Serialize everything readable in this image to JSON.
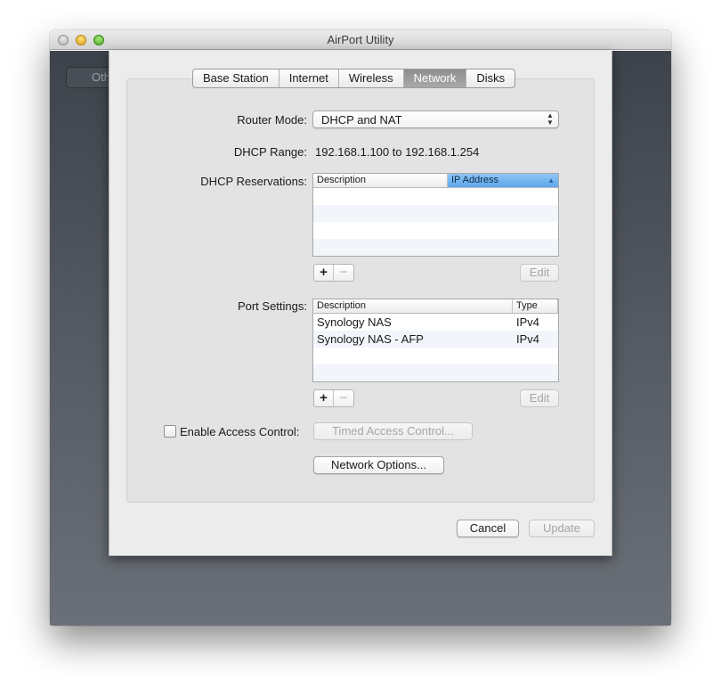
{
  "window": {
    "title": "AirPort Utility"
  },
  "background": {
    "other_button_label": "Oth"
  },
  "tabs": [
    {
      "label": "Base Station",
      "active": false
    },
    {
      "label": "Internet",
      "active": false
    },
    {
      "label": "Wireless",
      "active": false
    },
    {
      "label": "Network",
      "active": true
    },
    {
      "label": "Disks",
      "active": false
    }
  ],
  "router_mode": {
    "label": "Router Mode:",
    "value": "DHCP and NAT"
  },
  "dhcp_range": {
    "label": "DHCP Range:",
    "value": "192.168.1.100 to 192.168.1.254"
  },
  "dhcp_reservations": {
    "label": "DHCP Reservations:",
    "columns": [
      "Description",
      "IP Address"
    ],
    "sorted_column": "IP Address",
    "rows": [],
    "add_label": "+",
    "remove_label": "−",
    "edit_label": "Edit"
  },
  "port_settings": {
    "label": "Port Settings:",
    "columns": [
      "Description",
      "Type"
    ],
    "rows": [
      {
        "description": "Synology NAS",
        "type": "IPv4"
      },
      {
        "description": "Synology NAS - AFP",
        "type": "IPv4"
      }
    ],
    "add_label": "+",
    "remove_label": "−",
    "edit_label": "Edit"
  },
  "access_control": {
    "checkbox_label": "Enable Access Control:",
    "checked": false,
    "timed_button_label": "Timed Access Control..."
  },
  "network_options_label": "Network Options...",
  "footer": {
    "cancel_label": "Cancel",
    "update_label": "Update"
  }
}
